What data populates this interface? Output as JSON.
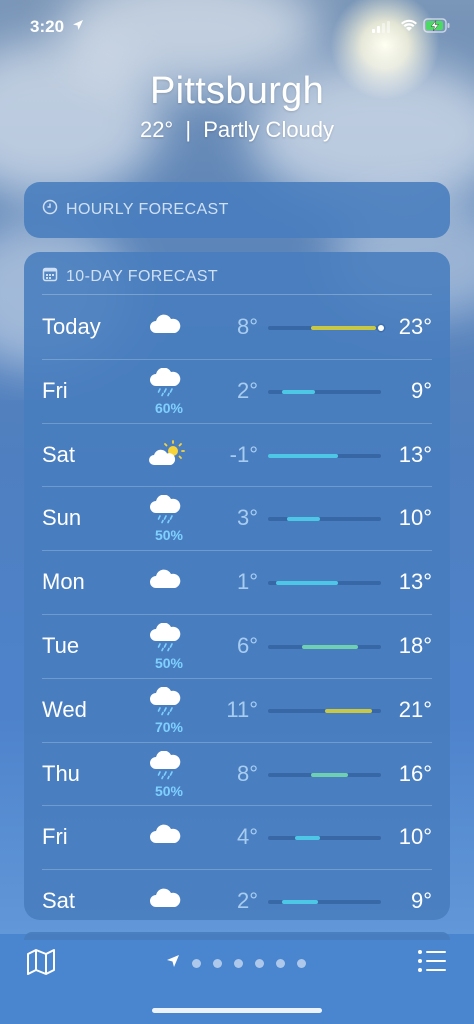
{
  "status_bar": {
    "time": "3:20"
  },
  "location": {
    "city": "Pittsburgh",
    "temp": "22°",
    "separator": "|",
    "condition": "Partly Cloudy"
  },
  "hourly": {
    "title": "HOURLY FORECAST"
  },
  "ten_day": {
    "title": "10-DAY FORECAST",
    "days": [
      {
        "day": "Today",
        "icon": "cloud-icon",
        "precip": "",
        "low": "8°",
        "high": "23°",
        "bar_start": 0.38,
        "bar_end": 0.96,
        "color": "#c8c845",
        "current_dot": true
      },
      {
        "day": "Fri",
        "icon": "cloud-rain-icon",
        "precip": "60%",
        "low": "2°",
        "high": "9°",
        "bar_start": 0.12,
        "bar_end": 0.42,
        "color": "#4ec7e6"
      },
      {
        "day": "Sat",
        "icon": "partly-sunny-icon",
        "precip": "",
        "low": "-1°",
        "high": "13°",
        "bar_start": 0.0,
        "bar_end": 0.62,
        "color": "#4ec7e6"
      },
      {
        "day": "Sun",
        "icon": "cloud-rain-icon",
        "precip": "50%",
        "low": "3°",
        "high": "10°",
        "bar_start": 0.17,
        "bar_end": 0.46,
        "color": "#4ec7e6"
      },
      {
        "day": "Mon",
        "icon": "cloud-icon",
        "precip": "",
        "low": "1°",
        "high": "13°",
        "bar_start": 0.07,
        "bar_end": 0.62,
        "color": "#4ec7e6"
      },
      {
        "day": "Tue",
        "icon": "cloud-rain-icon",
        "precip": "50%",
        "low": "6°",
        "high": "18°",
        "bar_start": 0.3,
        "bar_end": 0.8,
        "color": "#6ed0b0"
      },
      {
        "day": "Wed",
        "icon": "cloud-rain-icon",
        "precip": "70%",
        "low": "11°",
        "high": "21°",
        "bar_start": 0.5,
        "bar_end": 0.92,
        "color": "#c8c845"
      },
      {
        "day": "Thu",
        "icon": "cloud-rain-icon",
        "precip": "50%",
        "low": "8°",
        "high": "16°",
        "bar_start": 0.38,
        "bar_end": 0.71,
        "color": "#6ed0b0"
      },
      {
        "day": "Fri",
        "icon": "cloud-icon",
        "precip": "",
        "low": "4°",
        "high": "10°",
        "bar_start": 0.24,
        "bar_end": 0.46,
        "color": "#4ec7e6"
      },
      {
        "day": "Sat",
        "icon": "cloud-icon",
        "precip": "",
        "low": "2°",
        "high": "9°",
        "bar_start": 0.12,
        "bar_end": 0.44,
        "color": "#4ec7e6"
      }
    ]
  },
  "page_dots": {
    "count": 6
  }
}
